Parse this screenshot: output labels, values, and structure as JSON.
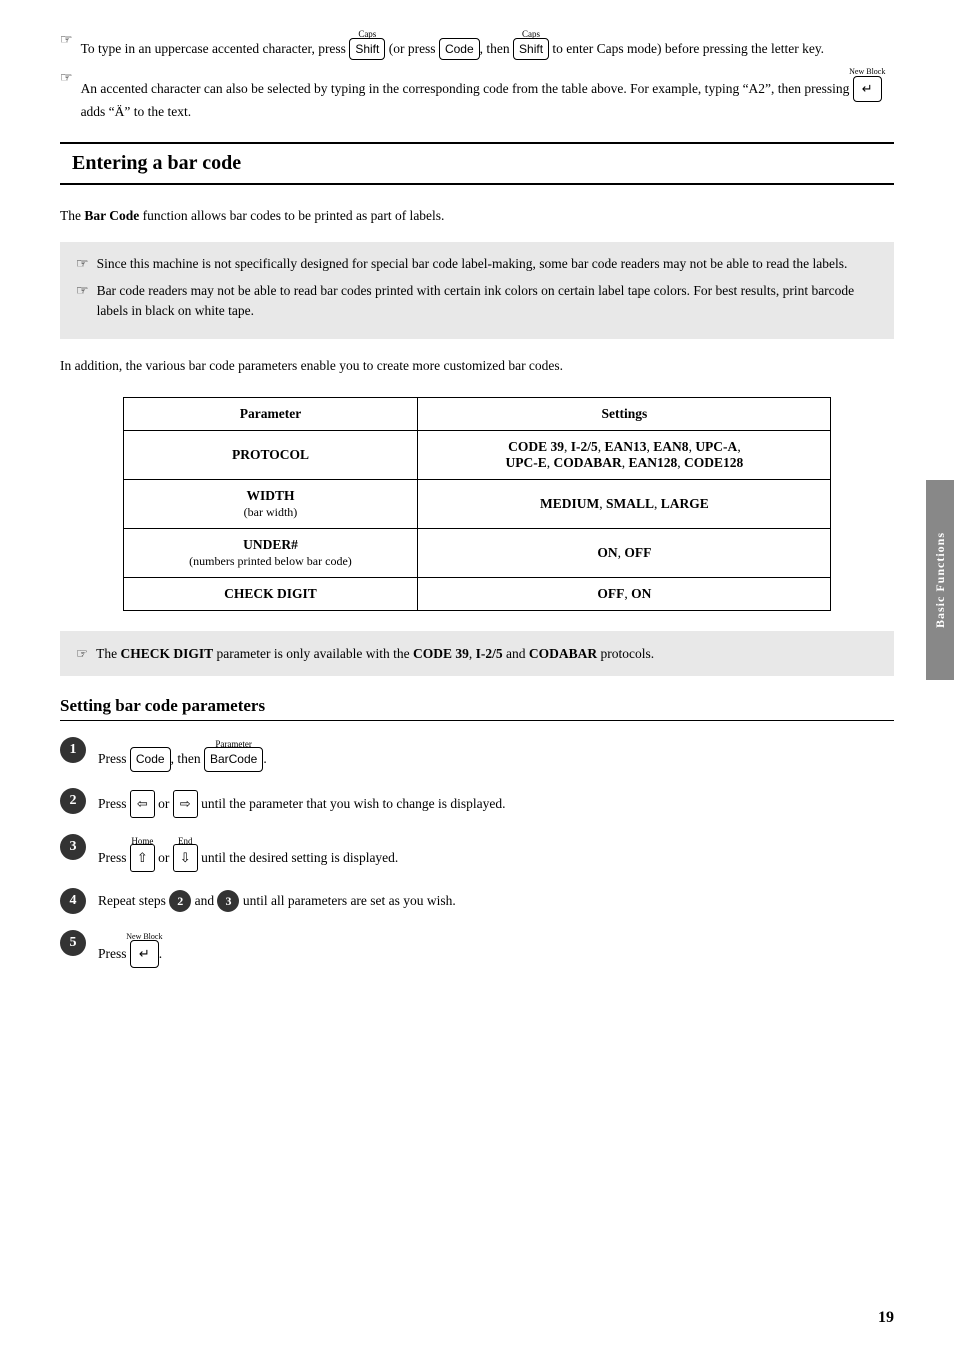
{
  "page": {
    "number": "19",
    "side_tab": "Basic Functions"
  },
  "top_section": {
    "notes": [
      {
        "id": "note1",
        "text": "To type in an uppercase accented character, press",
        "key1_label": "Caps",
        "key1": "Shift",
        "middle": "(or press",
        "key2": "Code",
        "then": ", then",
        "key3_label": "Caps",
        "key3": "Shift",
        "end": "to enter Caps mode) before pressing the letter key."
      },
      {
        "id": "note2",
        "text": "An accented character can also be selected by typing in the corresponding code from the table above. For example, typing “A2”, then pressing",
        "key_label": "New Block",
        "key": "↵",
        "end": "adds “Ä” to the text."
      }
    ]
  },
  "entering_barcode": {
    "heading": "Entering a bar code",
    "intro": "The Bar Code function allows bar codes to be printed as part of labels.",
    "grey_notes": [
      "Since this machine is not specifically designed for special bar code label-making, some bar code readers may not be able to read the labels.",
      "Bar code readers may not be able to read bar codes printed with certain ink colors on certain label tape colors. For best results, print barcode labels in black on white tape."
    ],
    "body": "In addition, the various bar code parameters enable you to create more customized bar codes.",
    "table": {
      "headers": [
        "Parameter",
        "Settings"
      ],
      "rows": [
        {
          "param": "PROTOCOL",
          "param_sub": "",
          "settings": "CODE 39, I-2/5, EAN13, EAN8, UPC-A,\nUPC-E, CODABAR, EAN128, CODE128"
        },
        {
          "param": "WIDTH",
          "param_sub": "(bar width)",
          "settings": "MEDIUM, SMALL, LARGE"
        },
        {
          "param": "UNDER#",
          "param_sub": "(numbers printed below bar code)",
          "settings": "ON, OFF"
        },
        {
          "param": "CHECK DIGIT",
          "param_sub": "",
          "settings": "OFF, ON"
        }
      ]
    },
    "check_digit_note": "The CHECK DIGIT parameter is only available with the CODE 39, I-2/5 and CODABAR protocols."
  },
  "setting_params": {
    "heading": "Setting bar code parameters",
    "steps": [
      {
        "num": "1",
        "text": "Press",
        "key": "Code",
        "then": ", then",
        "key2_label": "Parameter",
        "key2": "BarCode",
        "end": "."
      },
      {
        "num": "2",
        "text": "Press",
        "arrow_left": "⇦",
        "or": "or",
        "arrow_right": "⇨",
        "end": "until the parameter that you wish to change is displayed."
      },
      {
        "num": "3",
        "text": "Press",
        "arrow_up_label": "Home",
        "arrow_up": "↑",
        "or": "or",
        "arrow_down_label": "End",
        "arrow_down": "↓",
        "end": "until the desired setting is displayed."
      },
      {
        "num": "4",
        "text": "Repeat steps",
        "step2ref": "2",
        "and": "and",
        "step3ref": "3",
        "end": "until all parameters are set as you wish."
      },
      {
        "num": "5",
        "text": "Press",
        "key_label": "New Block",
        "key": "↵",
        "end": "."
      }
    ]
  }
}
